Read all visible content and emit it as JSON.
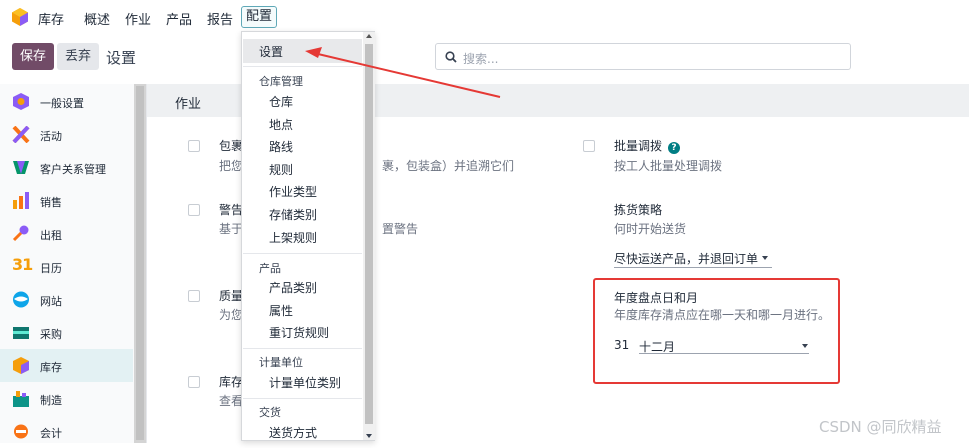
{
  "topbar": {
    "app_name": "库存",
    "menus": [
      "概述",
      "作业",
      "产品",
      "报告",
      "配置"
    ]
  },
  "controls": {
    "save": "保存",
    "discard": "丢弃",
    "breadcrumb": "设置",
    "search_placeholder": "搜索..."
  },
  "sidebar": {
    "items": [
      {
        "label": "一般设置",
        "icon": "odoo-logo-icon"
      },
      {
        "label": "活动",
        "icon": "activity-icon"
      },
      {
        "label": "客户关系管理",
        "icon": "crm-icon"
      },
      {
        "label": "销售",
        "icon": "sales-chart-icon"
      },
      {
        "label": "出租",
        "icon": "key-icon"
      },
      {
        "label": "日历",
        "icon": "calendar-icon"
      },
      {
        "label": "网站",
        "icon": "website-icon"
      },
      {
        "label": "采购",
        "icon": "purchase-icon"
      },
      {
        "label": "库存",
        "icon": "inventory-icon"
      },
      {
        "label": "制造",
        "icon": "manufacturing-icon"
      },
      {
        "label": "会计",
        "icon": "accounting-icon"
      }
    ],
    "selected": "库存"
  },
  "section": {
    "title": "作业"
  },
  "settings_left": [
    {
      "label": "包裹",
      "desc": "把您",
      "desc_tail": "裹，包装盒）并追溯它们"
    },
    {
      "label": "警告",
      "desc": "基于",
      "desc_tail": "置警告"
    },
    {
      "label": "质量",
      "desc": "为您"
    },
    {
      "label": "库存",
      "desc": "查看"
    }
  ],
  "settings_right": {
    "batch": {
      "label": "批量调拨",
      "help": "?",
      "desc": "按工人批量处理调拨"
    },
    "picking": {
      "label": "拣货策略",
      "desc": "何时开始送货",
      "value": "尽快运送产品，并退回订单"
    },
    "annual": {
      "label": "年度盘点日和月",
      "desc": "年度库存清点应在哪一天和哪一月进行。",
      "day": "31",
      "month": "十二月"
    }
  },
  "dropdown": {
    "settings": "设置",
    "groups": [
      {
        "header": "仓库管理",
        "items": [
          "仓库",
          "地点",
          "路线",
          "规则",
          "作业类型",
          "存储类别",
          "上架规则"
        ]
      },
      {
        "header": "产品",
        "items": [
          "产品类别",
          "属性",
          "重订货规则"
        ]
      },
      {
        "header": "计量单位",
        "items": [
          "计量单位类别"
        ]
      },
      {
        "header": "交货",
        "items": [
          "送货方式"
        ]
      }
    ]
  },
  "watermark": "CSDN @同欣精益",
  "colors": {
    "brand": "#714b67",
    "accent": "#017e84",
    "highlight": "#e53935"
  }
}
